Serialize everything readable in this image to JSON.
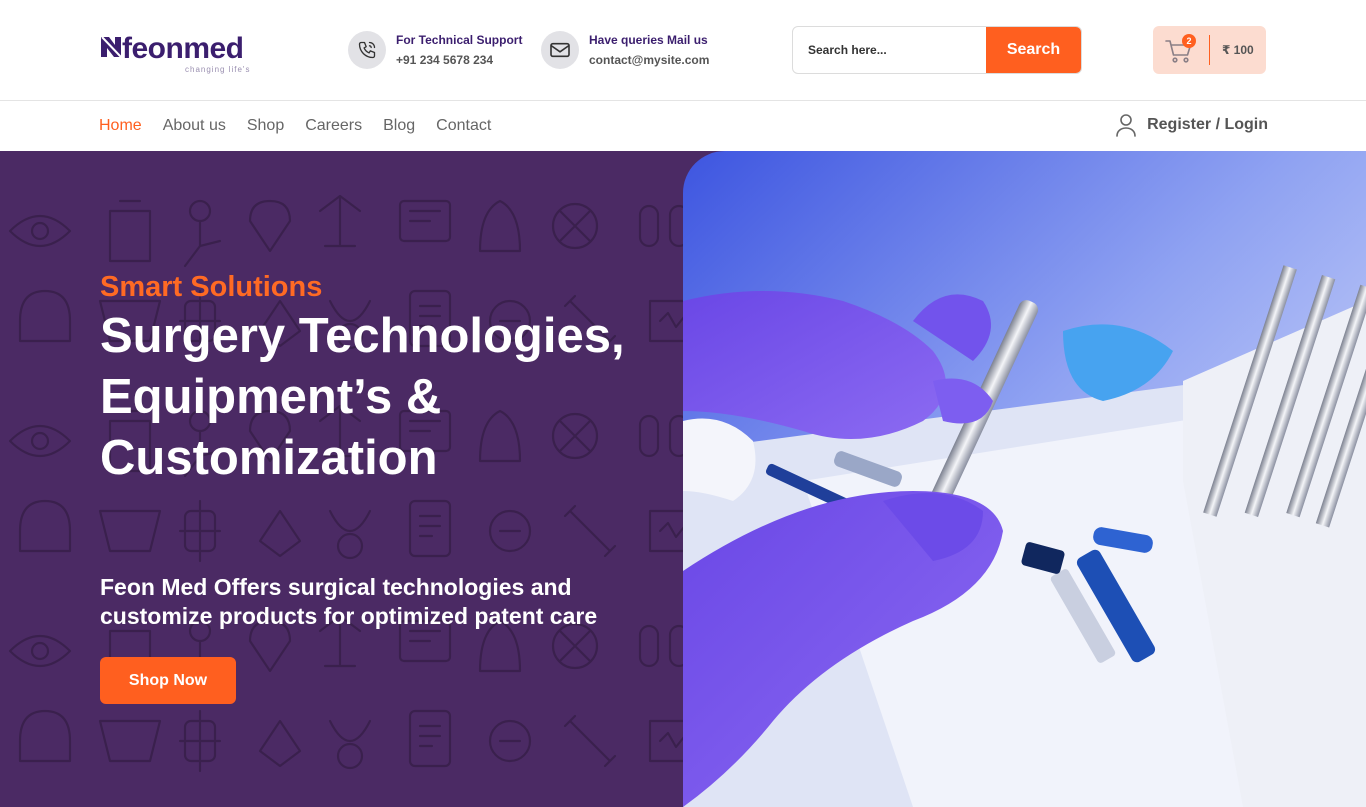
{
  "brand": {
    "name": "feonmed",
    "tagline": "changing life's"
  },
  "contacts": [
    {
      "icon": "phone-icon",
      "title": "For Technical Support",
      "value": "+91 234 5678 234"
    },
    {
      "icon": "mail-icon",
      "title": "Have queries Mail us",
      "value": "contact@mysite.com"
    }
  ],
  "search": {
    "placeholder": "Search here...",
    "button_label": "Search"
  },
  "cart": {
    "icon": "cart-icon",
    "count": "2",
    "total": "₹ 100"
  },
  "nav": {
    "items": [
      {
        "label": "Home",
        "active": true
      },
      {
        "label": "About us"
      },
      {
        "label": "Shop"
      },
      {
        "label": "Careers"
      },
      {
        "label": "Blog"
      },
      {
        "label": "Contact"
      }
    ],
    "login_label": "Register / Login",
    "login_icon": "user-icon"
  },
  "hero": {
    "eyebrow": "Smart Solutions",
    "headline": "Surgery Technologies, Equipment’s & Customization",
    "subheadline": "Feon Med Offers surgical technologies and customize products for optimized patent care",
    "cta_label": "Shop Now"
  },
  "colors": {
    "accent": "#ff5f1f",
    "brand_purple": "#3b1e6e",
    "hero_bg": "#4b2a64",
    "cart_bg": "#fcdcd0"
  }
}
